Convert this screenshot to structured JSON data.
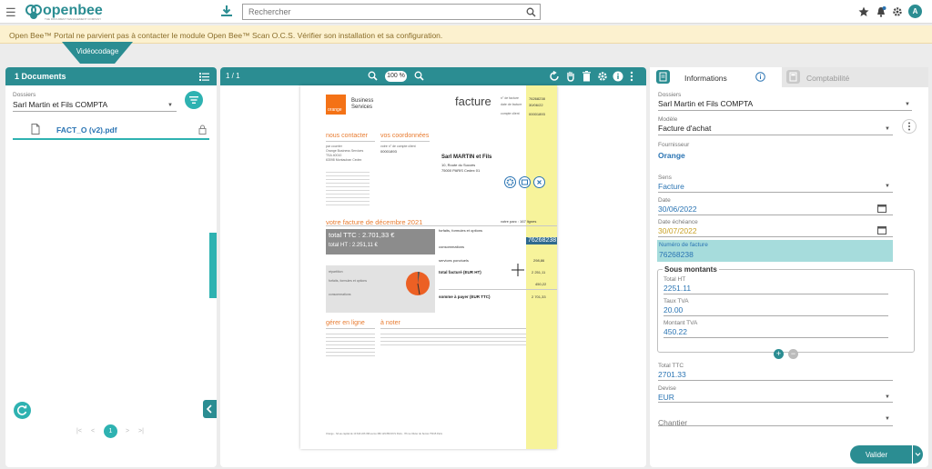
{
  "app": {
    "menu_icon": "hamburger-icon",
    "logo_text": "openbee",
    "logo_tagline": "THE DOCUMENT MANAGEMENT COMPANY",
    "search_placeholder": "Rechercher",
    "avatar_initial": "A",
    "brand_color": "#2b8d92",
    "accent_color": "#2eb2b1"
  },
  "warning": {
    "text": "Open Bee™ Portal ne parvient pas à contacter le module Open Bee™ Scan O.C.S. Vérifier son installation et sa configuration."
  },
  "mode_tab": "Vidéocodage",
  "left": {
    "header": "1 Documents",
    "folder_label": "Dossiers",
    "folder_value": "Sarl Martin et Fils COMPTA",
    "file_name": "FACT_O (v2).pdf",
    "current_page": "1"
  },
  "viewer": {
    "page_indicator": "1 / 1",
    "zoom": "100 %"
  },
  "document": {
    "brand_line1": "Business",
    "brand_line2": "Services",
    "brand_logo": "orange",
    "title": "facture",
    "ref_label1": "n° de facture",
    "ref_value1": "76268238",
    "ref_label2": "date de facture",
    "ref_value2": "30/06/22",
    "ref_label3": "compte client",
    "ref_value3": "00001893",
    "section_contact": "nous contacter",
    "section_coords": "vos coordonnées",
    "contact_lines": [
      "par courrier",
      "Orange Business Services",
      "TSA 40010",
      "63098 Montauban Cedex"
    ],
    "coords_lines": [
      "votre n° de compte client",
      "00001893"
    ],
    "recipient_name": "Sarl MARTIN et Fils",
    "recipient_addr1": "10, Route du Succès",
    "recipient_addr2": "75000 PARIS Cedex 01",
    "invoice_heading": "votre facture de décembre 2021",
    "parc_label": "votre parc : 167 lignes",
    "total_ttc_label": "total TTC : 2.701,33 €",
    "total_ht_label": "total HT : 2.251,11 €",
    "highlight_value": "76268238",
    "line_forfaits": "forfaits, formules et options",
    "line_conso": "consommations",
    "line_services": "services ponctuels",
    "line_total_ht": "total facturé (EUR HT)",
    "line_total_ht_value": "2 251,11",
    "line_tva_value": "450,22",
    "line_pay": "somme à payer (EUR TTC)",
    "line_pay_value": "2 701,33",
    "line_services_value": "298,86",
    "repartition": "répartition",
    "section_manage": "gérer en ligne",
    "section_note": "à noter",
    "footer": "Orange - SA au capital de 10 640 226 396 euros 380 129 866 RCS Paris - 78 rue Olivier de Serres 75015 Paris"
  },
  "right": {
    "tab_info": "Informations",
    "tab_compta": "Comptabilité",
    "folder_label": "Dossiers",
    "folder_value": "Sarl Martin et Fils COMPTA",
    "model_label": "Modèle",
    "model_value": "Facture d'achat",
    "supplier_label": "Fournisseur",
    "supplier_value": "Orange",
    "direction_label": "Sens",
    "direction_value": "Facture",
    "date_label": "Date",
    "date_value": "30/06/2022",
    "due_label": "Date échéance",
    "due_value": "30/07/2022",
    "invoice_num_label": "Numéro de facture",
    "invoice_num_value": "76268238",
    "sub_title": "Sous montants",
    "total_ht_label": "Total HT",
    "total_ht_value": "2251.11",
    "tva_rate_label": "Taux TVA",
    "tva_rate_value": "20.00",
    "tva_amount_label": "Montant TVA",
    "tva_amount_value": "450.22",
    "total_ttc_label": "Total TTC",
    "total_ttc_value": "2701.33",
    "currency_label": "Devise",
    "currency_value": "EUR",
    "site_label": "Chantier",
    "validate_label": "Valider"
  }
}
